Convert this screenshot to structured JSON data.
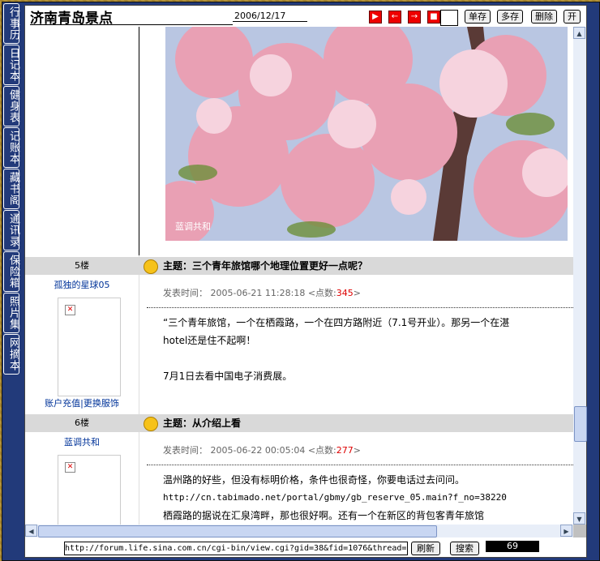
{
  "colors": {
    "tab_border": "#ffffff",
    "accent_red": "#dd0000",
    "header_bg": "#d9d9d9",
    "link": "#003399"
  },
  "sidebar": {
    "tabs": [
      "行事历",
      "日记本",
      "健身表",
      "记账本",
      "藏书阁",
      "通讯录",
      "保险箱",
      "照片集",
      "网摘本"
    ]
  },
  "window": {
    "title": "济南青岛景点",
    "date": "2006/12/17",
    "icons": [
      "play-icon",
      "back-icon",
      "forward-icon",
      "stop-icon"
    ],
    "buttons": {
      "save_single": "单存",
      "save_multi": "多存",
      "delete": "删除",
      "open": "开"
    }
  },
  "photo": {
    "caption": "蓝调共和"
  },
  "posts": [
    {
      "floor": "5楼",
      "author": "孤独的星球05",
      "subject": "主题：三个青年旅馆哪个地理位置更好一点呢？",
      "time_label": "发表时间：",
      "time": "2005-06-21 11:28:18",
      "clicks_prefix": "<点数:",
      "clicks": "345",
      "clicks_suffix": ">",
      "lines": [
        "“三个青年旅馆，一个在栖霞路，一个在四方路附近（7.1号开业）。那另一个在湛",
        "hotel还是住不起啊！",
        "",
        "7月1日去看中国电子消费展。"
      ],
      "links": "账户充值|更换服饰"
    },
    {
      "floor": "6楼",
      "author": "蓝调共和",
      "subject": "主题：从介绍上看",
      "time_label": "发表时间：",
      "time": "2005-06-22 00:05:04",
      "clicks_prefix": "<点数:",
      "clicks": "277",
      "clicks_suffix": ">",
      "lines": [
        "温州路的好些，但没有标明价格，条件也很奇怪，你要电话过去问问。",
        "http://cn.tabimado.net/portal/gbmy/gb_reserve_05.main?f_no=38220",
        "栖霞路的据说在汇泉湾畔，那也很好啊。还有一个在新区的背包客青年旅馆"
      ]
    }
  ],
  "address": {
    "url": "http://forum.life.sina.com.cn/cgi-bin/view.cgi?gid=38&fid=1076&thread=",
    "refresh": "刷新",
    "search": "搜索",
    "counter": "69"
  }
}
